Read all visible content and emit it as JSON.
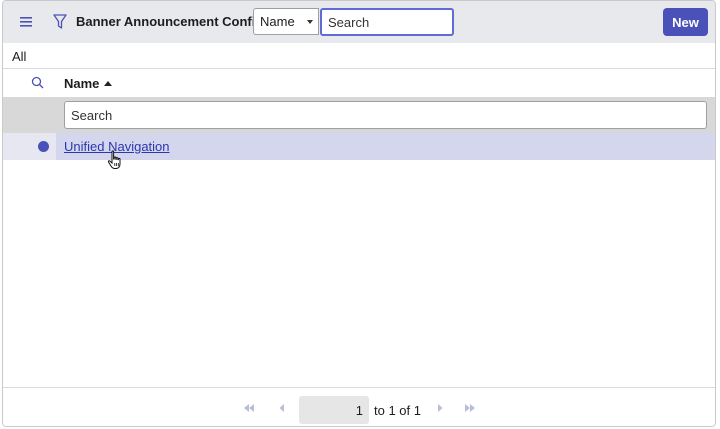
{
  "header": {
    "title": "Banner Announcement Configs",
    "field_select_value": "Name",
    "search_placeholder": "Search",
    "new_label": "New"
  },
  "breadcrumb": {
    "label": "All"
  },
  "columns": {
    "name_label": "Name",
    "search_placeholder": "Search"
  },
  "rows": [
    {
      "name": "Unified Navigation"
    }
  ],
  "pagination": {
    "page_value": "1",
    "info": "to 1 of 1"
  },
  "colors": {
    "accent": "#4a51b8",
    "row_highlight": "#d4d6ee",
    "link": "#2b38b0"
  },
  "icons": [
    "menu-icon",
    "filter-icon",
    "search-icon",
    "sort-ascending-icon",
    "cursor-hand-icon",
    "first-page-icon",
    "previous-page-icon",
    "next-page-icon",
    "last-page-icon"
  ]
}
